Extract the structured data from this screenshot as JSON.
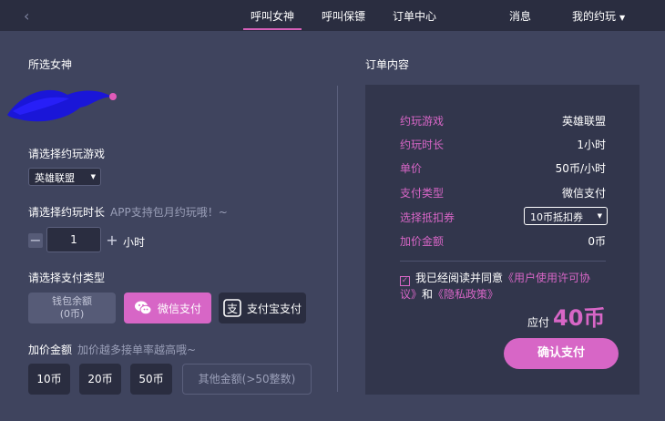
{
  "topbar": {
    "nav": [
      "呼叫女神",
      "呼叫保镖",
      "订单中心",
      "消息",
      "我的约玩"
    ]
  },
  "left": {
    "selected_goddess_title": "所选女神",
    "game": {
      "title": "请选择约玩游戏",
      "selected": "英雄联盟"
    },
    "duration": {
      "title": "请选择约玩时长",
      "hint": "APP支持包月约玩哦！~",
      "value": "1",
      "unit": "小时"
    },
    "payment": {
      "title": "请选择支付类型",
      "wallet_label": "钱包余额",
      "wallet_amount": "(0币)",
      "wechat_label": "微信支付",
      "alipay_label": "支付宝支付"
    },
    "premium": {
      "title": "加价金额",
      "hint": "加价越多接单率越高哦~",
      "options": [
        "10币",
        "20币",
        "50币"
      ],
      "custom_placeholder": "其他金额(>50整数)"
    }
  },
  "order": {
    "title": "订单内容",
    "rows": [
      {
        "k": "约玩游戏",
        "v": "英雄联盟"
      },
      {
        "k": "约玩时长",
        "v": "1小时"
      },
      {
        "k": "单价",
        "v": "50币/小时"
      },
      {
        "k": "支付类型",
        "v": "微信支付"
      },
      {
        "k": "选择抵扣券",
        "v": "10币抵扣券"
      },
      {
        "k": "加价金额",
        "v": "0币"
      }
    ],
    "agree_prefix": "我已经阅读并同意",
    "agree_link1": "《用户使用许可协议》",
    "agree_and": "和",
    "agree_link2": "《隐私政策》",
    "pay_label": "应付",
    "pay_amount": "40币",
    "confirm": "确认支付"
  },
  "colors": {
    "accent": "#d766c6",
    "bg": "#3f445e",
    "panel": "#32364c",
    "topbar": "#2a2d40"
  }
}
